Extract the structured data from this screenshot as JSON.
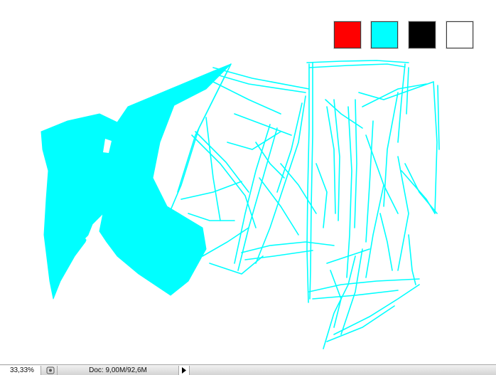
{
  "palette": [
    {
      "name": "red",
      "color": "#ff0000"
    },
    {
      "name": "cyan",
      "color": "#00ffff"
    },
    {
      "name": "black",
      "color": "#000000"
    },
    {
      "name": "white",
      "color": "#ffffff"
    }
  ],
  "canvas": {
    "stroke_color": "#00ffff"
  },
  "statusbar": {
    "zoom": "33,33%",
    "doc_info": "Doc: 9,00M/92,6M",
    "info_icon": "document-info-icon",
    "menu_icon": "triangle-right-icon"
  }
}
